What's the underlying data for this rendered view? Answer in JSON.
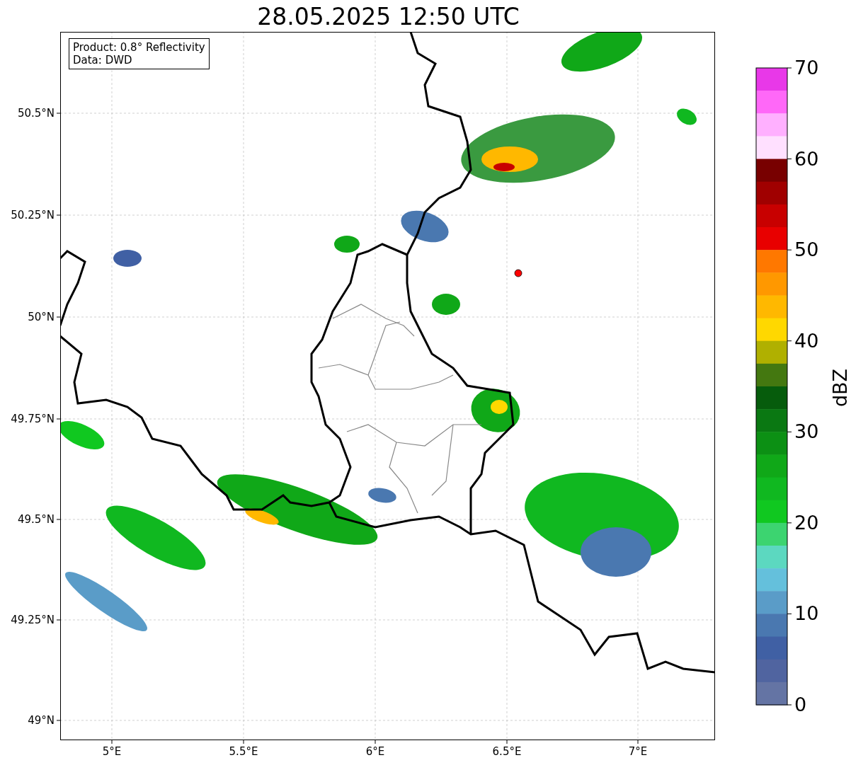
{
  "title": "28.05.2025 12:50 UTC",
  "info_box": [
    "Product: 0.8° Reflectivity",
    "Data: DWD"
  ],
  "map": {
    "lat_labels": [
      "50.5°N",
      "50.25°N",
      "50°N",
      "49.75°N",
      "49.5°N",
      "49.25°N",
      "49°N"
    ],
    "lon_labels": [
      "5°E",
      "5.5°E",
      "6°E",
      "6.5°E",
      "7°E"
    ]
  },
  "colorbar": {
    "label": "dBZ",
    "ticks": [
      "70",
      "60",
      "50",
      "40",
      "30",
      "20",
      "10",
      "0"
    ],
    "bins": [
      {
        "color": "#e838e8"
      },
      {
        "color": "#ff68f8"
      },
      {
        "color": "#ffb0ff"
      },
      {
        "color": "#ffe0ff"
      },
      {
        "color": "#780000"
      },
      {
        "color": "#a00000"
      },
      {
        "color": "#c80000"
      },
      {
        "color": "#e80000"
      },
      {
        "color": "#ff7800"
      },
      {
        "color": "#ff9800"
      },
      {
        "color": "#ffb800"
      },
      {
        "color": "#ffd800"
      },
      {
        "color": "#b0b000"
      },
      {
        "color": "#447810"
      },
      {
        "color": "#065c0c"
      },
      {
        "color": "#0a7812"
      },
      {
        "color": "#0c9014"
      },
      {
        "color": "#10a818"
      },
      {
        "color": "#10b820"
      },
      {
        "color": "#10c820"
      },
      {
        "color": "#3cd470"
      },
      {
        "color": "#5cd8c0"
      },
      {
        "color": "#64c0dc"
      },
      {
        "color": "#5a9cc8"
      },
      {
        "color": "#4a78b0"
      },
      {
        "color": "#4060a4"
      },
      {
        "color": "#5064a0"
      },
      {
        "color": "#6474a4"
      }
    ]
  }
}
